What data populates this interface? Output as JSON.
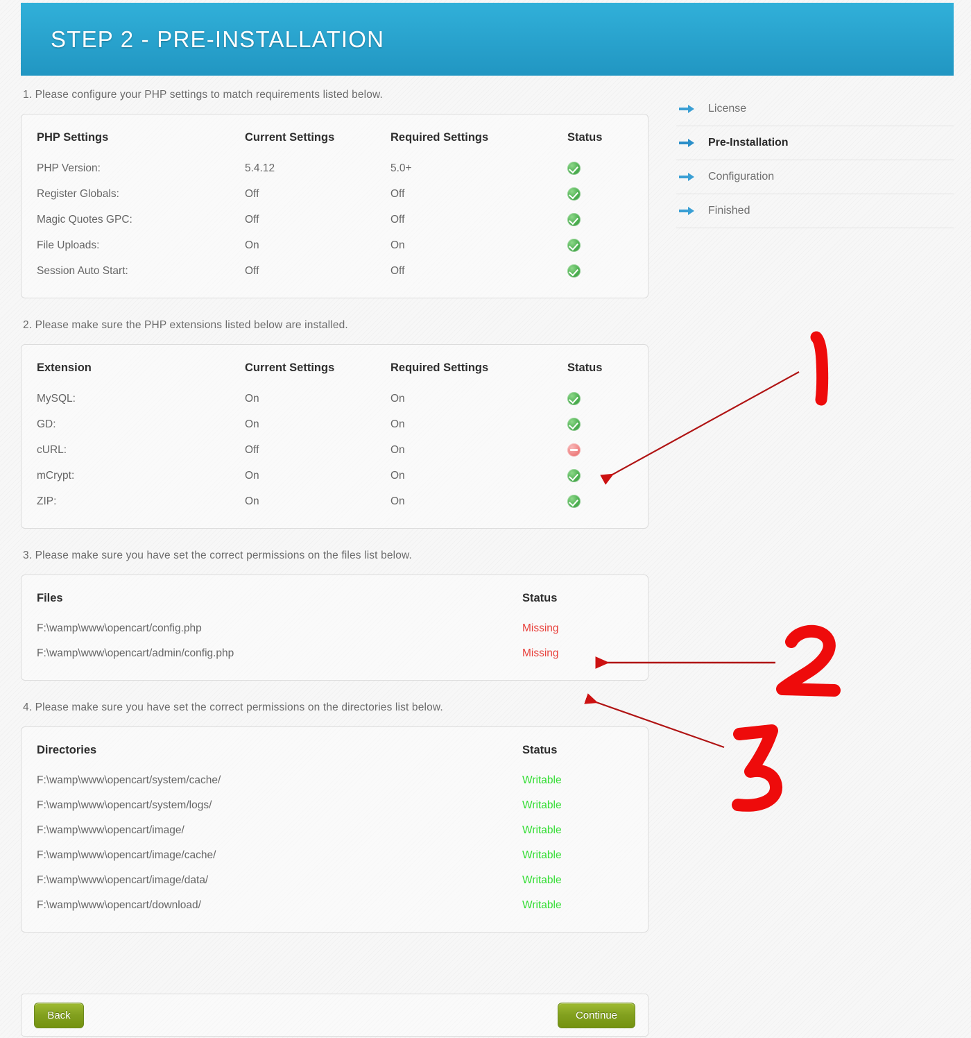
{
  "header": {
    "title": "STEP 2 - PRE-INSTALLATION",
    "bg_color": "#2aa9d4"
  },
  "sections": {
    "php_settings": {
      "note": "1. Please configure your PHP settings to match requirements listed below.",
      "columns": [
        "PHP Settings",
        "Current Settings",
        "Required Settings",
        "Status"
      ],
      "rows": [
        {
          "name": "PHP Version:",
          "current": "5.4.12",
          "required": "5.0+",
          "status": "ok",
          "status_icon": "check-circle-icon"
        },
        {
          "name": "Register Globals:",
          "current": "Off",
          "required": "Off",
          "status": "ok",
          "status_icon": "check-circle-icon"
        },
        {
          "name": "Magic Quotes GPC:",
          "current": "Off",
          "required": "Off",
          "status": "ok",
          "status_icon": "check-circle-icon"
        },
        {
          "name": "File Uploads:",
          "current": "On",
          "required": "On",
          "status": "ok",
          "status_icon": "check-circle-icon"
        },
        {
          "name": "Session Auto Start:",
          "current": "Off",
          "required": "Off",
          "status": "ok",
          "status_icon": "check-circle-icon"
        }
      ]
    },
    "extensions": {
      "note": "2. Please make sure the PHP extensions listed below are installed.",
      "columns": [
        "Extension",
        "Current Settings",
        "Required Settings",
        "Status"
      ],
      "rows": [
        {
          "name": "MySQL:",
          "current": "On",
          "required": "On",
          "status": "ok",
          "status_icon": "check-circle-icon"
        },
        {
          "name": "GD:",
          "current": "On",
          "required": "On",
          "status": "ok",
          "status_icon": "check-circle-icon"
        },
        {
          "name": "cURL:",
          "current": "Off",
          "required": "On",
          "status": "bad",
          "status_icon": "minus-circle-icon"
        },
        {
          "name": "mCrypt:",
          "current": "On",
          "required": "On",
          "status": "ok",
          "status_icon": "check-circle-icon"
        },
        {
          "name": "ZIP:",
          "current": "On",
          "required": "On",
          "status": "ok",
          "status_icon": "check-circle-icon"
        }
      ]
    },
    "files": {
      "note": "3. Please make sure you have set the correct permissions on the files list below.",
      "columns": [
        "Files",
        "Status"
      ],
      "rows": [
        {
          "name": "F:\\wamp\\www\\opencart/config.php",
          "status_text": "Missing",
          "status_state": "missing"
        },
        {
          "name": "F:\\wamp\\www\\opencart/admin/config.php",
          "status_text": "Missing",
          "status_state": "missing"
        }
      ]
    },
    "directories": {
      "note": "4. Please make sure you have set the correct permissions on the directories list below.",
      "columns": [
        "Directories",
        "Status"
      ],
      "rows": [
        {
          "name": "F:\\wamp\\www\\opencart/system/cache/",
          "status_text": "Writable",
          "status_state": "writable"
        },
        {
          "name": "F:\\wamp\\www\\opencart/system/logs/",
          "status_text": "Writable",
          "status_state": "writable"
        },
        {
          "name": "F:\\wamp\\www\\opencart/image/",
          "status_text": "Writable",
          "status_state": "writable"
        },
        {
          "name": "F:\\wamp\\www\\opencart/image/cache/",
          "status_text": "Writable",
          "status_state": "writable"
        },
        {
          "name": "F:\\wamp\\www\\opencart/image/data/",
          "status_text": "Writable",
          "status_state": "writable"
        },
        {
          "name": "F:\\wamp\\www\\opencart/download/",
          "status_text": "Writable",
          "status_state": "writable"
        }
      ]
    }
  },
  "sidebar": {
    "items": [
      {
        "label": "License",
        "active": false,
        "icon": "arrow-right-icon"
      },
      {
        "label": "Pre-Installation",
        "active": true,
        "icon": "arrow-right-icon"
      },
      {
        "label": "Configuration",
        "active": false,
        "icon": "arrow-right-icon"
      },
      {
        "label": "Finished",
        "active": false,
        "icon": "arrow-right-icon"
      }
    ]
  },
  "footer": {
    "back_label": "Back",
    "continue_label": "Continue"
  },
  "annotations": {
    "color": "#ee0b0b",
    "marks": [
      {
        "label": "1",
        "target": "curl-status-icon"
      },
      {
        "label": "2",
        "target": "files-row-0-status"
      },
      {
        "label": "3",
        "target": "files-row-1-status"
      }
    ]
  },
  "status_colors": {
    "missing": "#e8413c",
    "writable": "#33dd33",
    "ok_icon": "#4caf50",
    "bad_icon": "#ef8383"
  }
}
